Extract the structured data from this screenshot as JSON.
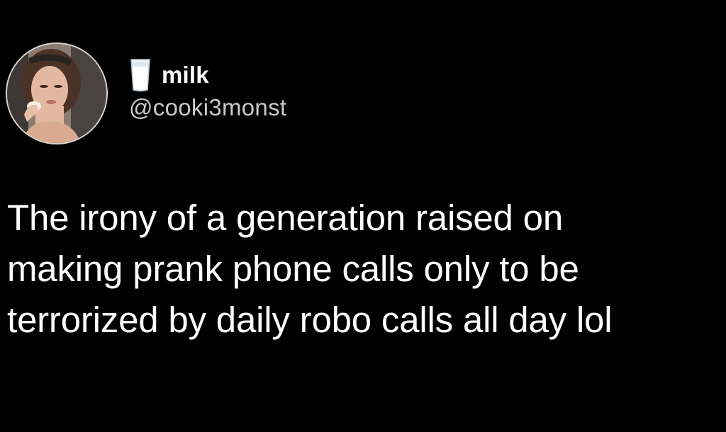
{
  "tweet": {
    "author": {
      "display_name": "milk",
      "handle": "@cooki3monst",
      "name_emoji": "milk-glass-icon",
      "avatar": "profile-photo"
    },
    "text_lines": [
      "The irony of a generation raised on",
      "making prank phone calls only to be",
      "terrorized by daily robo calls all day lol"
    ]
  },
  "colors": {
    "background": "#000000",
    "text": "#ffffff",
    "handle": "#c9c9c9"
  }
}
